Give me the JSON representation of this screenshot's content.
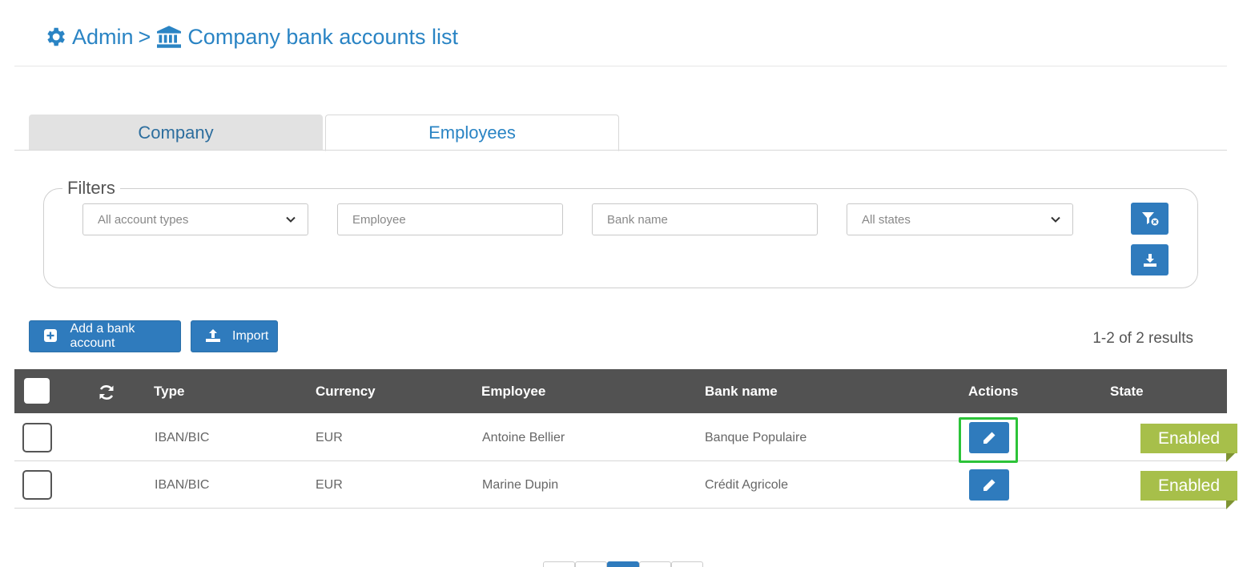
{
  "breadcrumb": {
    "root": "Admin",
    "separator": ">",
    "current": "Company bank accounts list",
    "root_icon": "gear-icon",
    "current_icon": "bank-icon"
  },
  "tabs": [
    {
      "label": "Company",
      "active": false
    },
    {
      "label": "Employees",
      "active": true
    }
  ],
  "filters": {
    "legend": "Filters",
    "account_type": {
      "selected": "All account types"
    },
    "employee": {
      "placeholder": "Employee",
      "value": ""
    },
    "bank_name": {
      "placeholder": "Bank name",
      "value": ""
    },
    "state": {
      "selected": "All states"
    },
    "clear_icon": "filter-clear-icon",
    "export_icon": "download-icon"
  },
  "toolbar": {
    "add_label": "Add a bank account",
    "import_label": "Import",
    "results": "1-2 of 2 results"
  },
  "table": {
    "columns": {
      "type": "Type",
      "currency": "Currency",
      "employee": "Employee",
      "bank_name": "Bank name",
      "actions": "Actions",
      "state": "State"
    },
    "rows": [
      {
        "type": "IBAN/BIC",
        "currency": "EUR",
        "employee": "Antoine Bellier",
        "bank_name": "Banque Populaire",
        "state": "Enabled"
      },
      {
        "type": "IBAN/BIC",
        "currency": "EUR",
        "employee": "Marine Dupin",
        "bank_name": "Crédit Agricole",
        "state": "Enabled"
      }
    ]
  },
  "colors": {
    "accent": "#2a84c4",
    "button": "#2f7bbd",
    "header_bg": "#525252",
    "state_enabled": "#a7bf4a",
    "highlight": "#2cc338"
  }
}
